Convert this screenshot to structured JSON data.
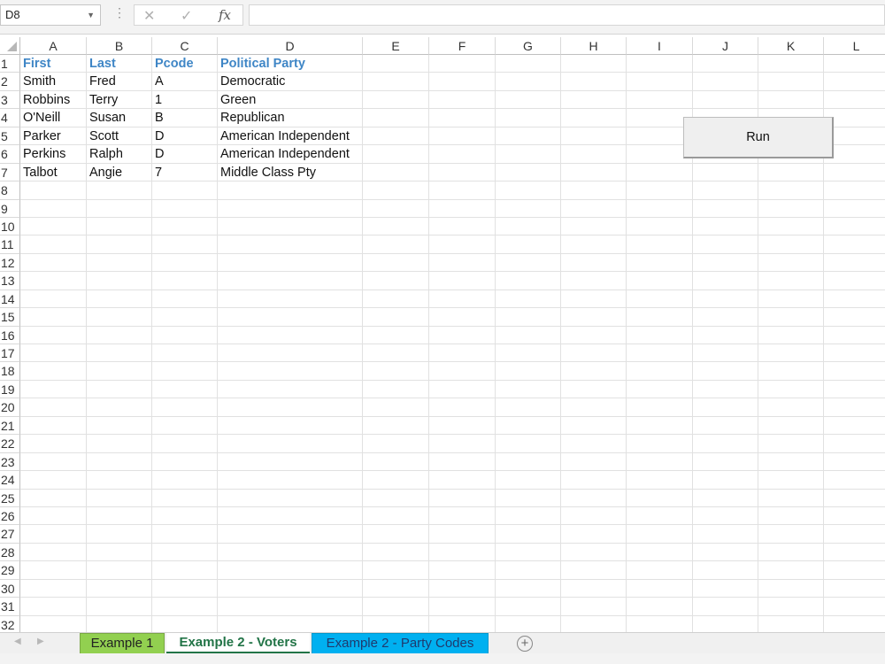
{
  "formula_bar": {
    "name_box": "D8",
    "cancel_icon": "✕",
    "enter_icon": "✓",
    "fx_label": "fx",
    "formula": ""
  },
  "columns": [
    "A",
    "B",
    "C",
    "D",
    "E",
    "F",
    "G",
    "H",
    "I",
    "J",
    "K",
    "L"
  ],
  "rows": [
    "1",
    "2",
    "3",
    "4",
    "5",
    "6",
    "7",
    "8",
    "9",
    "10",
    "11",
    "12",
    "13",
    "14",
    "15",
    "16",
    "17",
    "18",
    "19",
    "20",
    "21",
    "22",
    "23",
    "24",
    "25",
    "26",
    "27",
    "28",
    "29",
    "30",
    "31",
    "32"
  ],
  "table": {
    "headers": [
      "First",
      "Last",
      "Pcode",
      "Political Party"
    ],
    "data": [
      [
        "Smith",
        "Fred",
        "A",
        "Democratic"
      ],
      [
        "Robbins",
        "Terry",
        "1",
        "Green"
      ],
      [
        "O'Neill",
        "Susan",
        "B",
        "Republican"
      ],
      [
        "Parker",
        "Scott",
        "D",
        "American Independent"
      ],
      [
        "Perkins",
        "Ralph",
        "D",
        "American Independent"
      ],
      [
        "Talbot",
        "Angie",
        "7",
        "Middle Class Pty"
      ]
    ]
  },
  "run_button": "Run",
  "sheet_tabs": {
    "tabs": [
      "Example 1",
      "Example 2 - Voters",
      "Example 2 - Party Codes"
    ],
    "active": "Example 2 - Voters",
    "add_icon": "+"
  },
  "colors": {
    "header_text": "#3f86c6",
    "tab1": "#92d050",
    "tab_active_text": "#227447",
    "tab3": "#00b0f0"
  }
}
